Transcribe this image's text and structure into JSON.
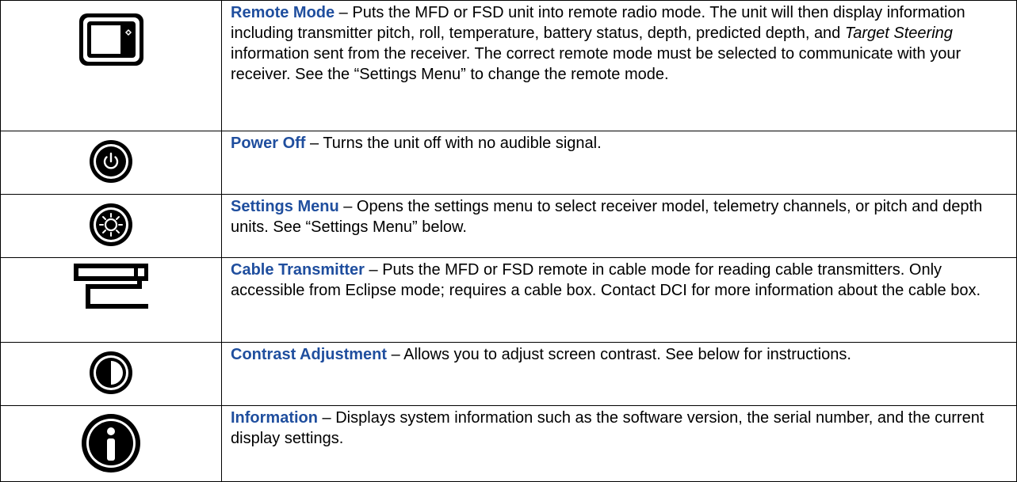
{
  "rows": [
    {
      "icon": "remote-mode-icon",
      "term": "Remote Mode",
      "parts": [
        " – Puts the MFD or FSD unit into remote radio mode. The unit will then display information including transmitter pitch, roll, temperature, battery status, depth, predicted depth, and ",
        "Target Steering",
        " information sent from the receiver. The correct remote mode must be selected to communicate with your receiver. See the “Settings Menu” to change the remote mode."
      ]
    },
    {
      "icon": "power-off-icon",
      "term": "Power Off",
      "text": " – Turns the unit off with no audible signal."
    },
    {
      "icon": "settings-menu-icon",
      "term": "Settings Menu",
      "text": " – Opens the settings menu to select receiver model, telemetry channels, or pitch and depth units. See “Settings Menu” below."
    },
    {
      "icon": "cable-transmitter-icon",
      "term": "Cable Transmitter",
      "text": " – Puts the MFD or FSD remote in cable mode for reading cable transmitters. Only accessible from Eclipse mode; requires a cable box. Contact DCI for more information about the cable box."
    },
    {
      "icon": "contrast-adjustment-icon",
      "term": "Contrast Adjustment",
      "text": " – Allows you to adjust screen contrast. See below for instructions."
    },
    {
      "icon": "information-icon",
      "term": "Information",
      "text": " – Displays system information such as the software version, the serial number, and the current display settings."
    }
  ]
}
